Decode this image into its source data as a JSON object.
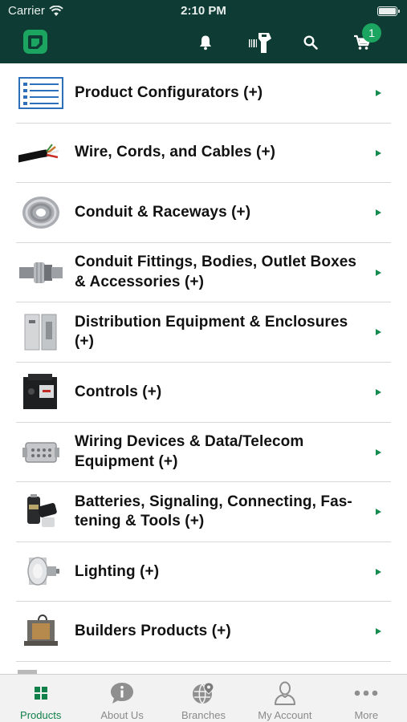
{
  "status_bar": {
    "carrier": "Carrier",
    "time": "2:10 PM"
  },
  "header": {
    "cart_count": "1"
  },
  "categories": [
    {
      "label": "Product Configurators (+)",
      "icon": "configurator-form-icon"
    },
    {
      "label": "Wire, Cords, and Cables (+)",
      "icon": "cable-icon"
    },
    {
      "label": "Conduit & Raceways (+)",
      "icon": "conduit-coil-icon"
    },
    {
      "label": "Conduit Fittings, Bodies, Outlet Box­es & Accessories (+)",
      "icon": "fitting-icon"
    },
    {
      "label": "Distribution Equipment & Enclo­sures (+)",
      "icon": "enclosure-icon"
    },
    {
      "label": "Controls (+)",
      "icon": "contactor-icon"
    },
    {
      "label": "Wiring Devices & Data/Telecom Equipment (+)",
      "icon": "connector-icon"
    },
    {
      "label": "Batteries, Signaling, Connecting, Fas­tening & Tools (+)",
      "icon": "battery-icon"
    },
    {
      "label": "Lighting (+)",
      "icon": "bulb-icon"
    },
    {
      "label": "Builders Products (+)",
      "icon": "transformer-icon"
    }
  ],
  "tabs": [
    {
      "label": "Products",
      "icon": "grid-icon",
      "active": true
    },
    {
      "label": "About Us",
      "icon": "info-bubble-icon",
      "active": false
    },
    {
      "label": "Branches",
      "icon": "globe-pin-icon",
      "active": false
    },
    {
      "label": "My Account",
      "icon": "person-icon",
      "active": false
    },
    {
      "label": "More",
      "icon": "more-dots-icon",
      "active": false
    }
  ],
  "colors": {
    "header_bg": "#0e3b33",
    "accent_green": "#1ba560",
    "arrow_green": "#138a4e",
    "tab_active": "#11804a",
    "tab_inactive": "#8a8a8a"
  }
}
